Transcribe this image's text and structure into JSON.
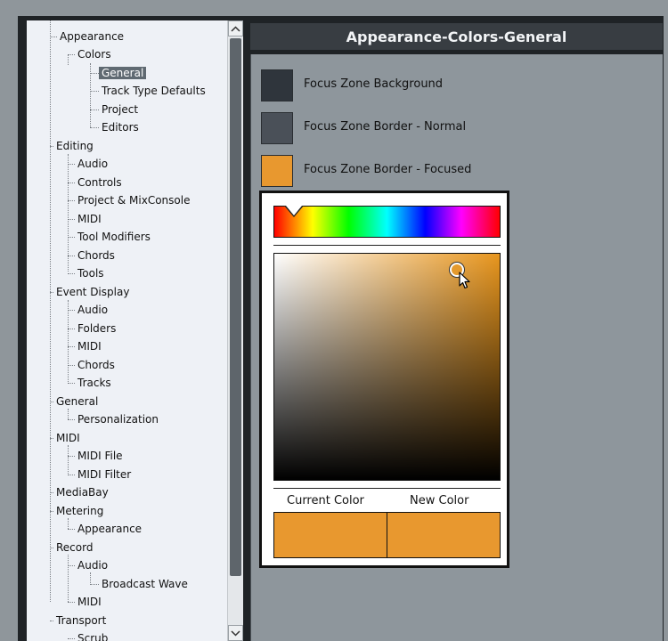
{
  "tree": {
    "items": [
      {
        "label": "Appearance"
      },
      {
        "label": "Colors"
      },
      {
        "label": "General",
        "selected": true
      },
      {
        "label": "Track Type Defaults"
      },
      {
        "label": "Project"
      },
      {
        "label": "Editors"
      },
      {
        "label": "Editing"
      },
      {
        "label": "Audio"
      },
      {
        "label": "Controls"
      },
      {
        "label": "Project & MixConsole"
      },
      {
        "label": "MIDI"
      },
      {
        "label": "Tool Modifiers"
      },
      {
        "label": "Chords"
      },
      {
        "label": "Tools"
      },
      {
        "label": "Event Display"
      },
      {
        "label": "Audio"
      },
      {
        "label": "Folders"
      },
      {
        "label": "MIDI"
      },
      {
        "label": "Chords"
      },
      {
        "label": "Tracks"
      },
      {
        "label": "General"
      },
      {
        "label": "Personalization"
      },
      {
        "label": "MIDI"
      },
      {
        "label": "MIDI File"
      },
      {
        "label": "MIDI Filter"
      },
      {
        "label": "MediaBay"
      },
      {
        "label": "Metering"
      },
      {
        "label": "Appearance"
      },
      {
        "label": "Record"
      },
      {
        "label": "Audio"
      },
      {
        "label": "Broadcast Wave"
      },
      {
        "label": "MIDI"
      },
      {
        "label": "Transport"
      },
      {
        "label": "Scrub"
      }
    ]
  },
  "panel": {
    "title": "Appearance-Colors-General",
    "colors": [
      {
        "label": "Focus Zone Background",
        "color": "#2f353c"
      },
      {
        "label": "Focus Zone Border - Normal",
        "color": "#4a5058"
      },
      {
        "label": "Focus Zone Border - Focused",
        "color": "#e8982f"
      }
    ]
  },
  "picker": {
    "current_label": "Current Color",
    "new_label": "New Color",
    "current_color": "#e8982f",
    "new_color": "#e8982f",
    "hue_color": "#e8961e"
  },
  "icons": {
    "scroll_up": "chevron-up-icon",
    "scroll_down": "chevron-down-icon",
    "cursor": "mouse-pointer-icon"
  }
}
